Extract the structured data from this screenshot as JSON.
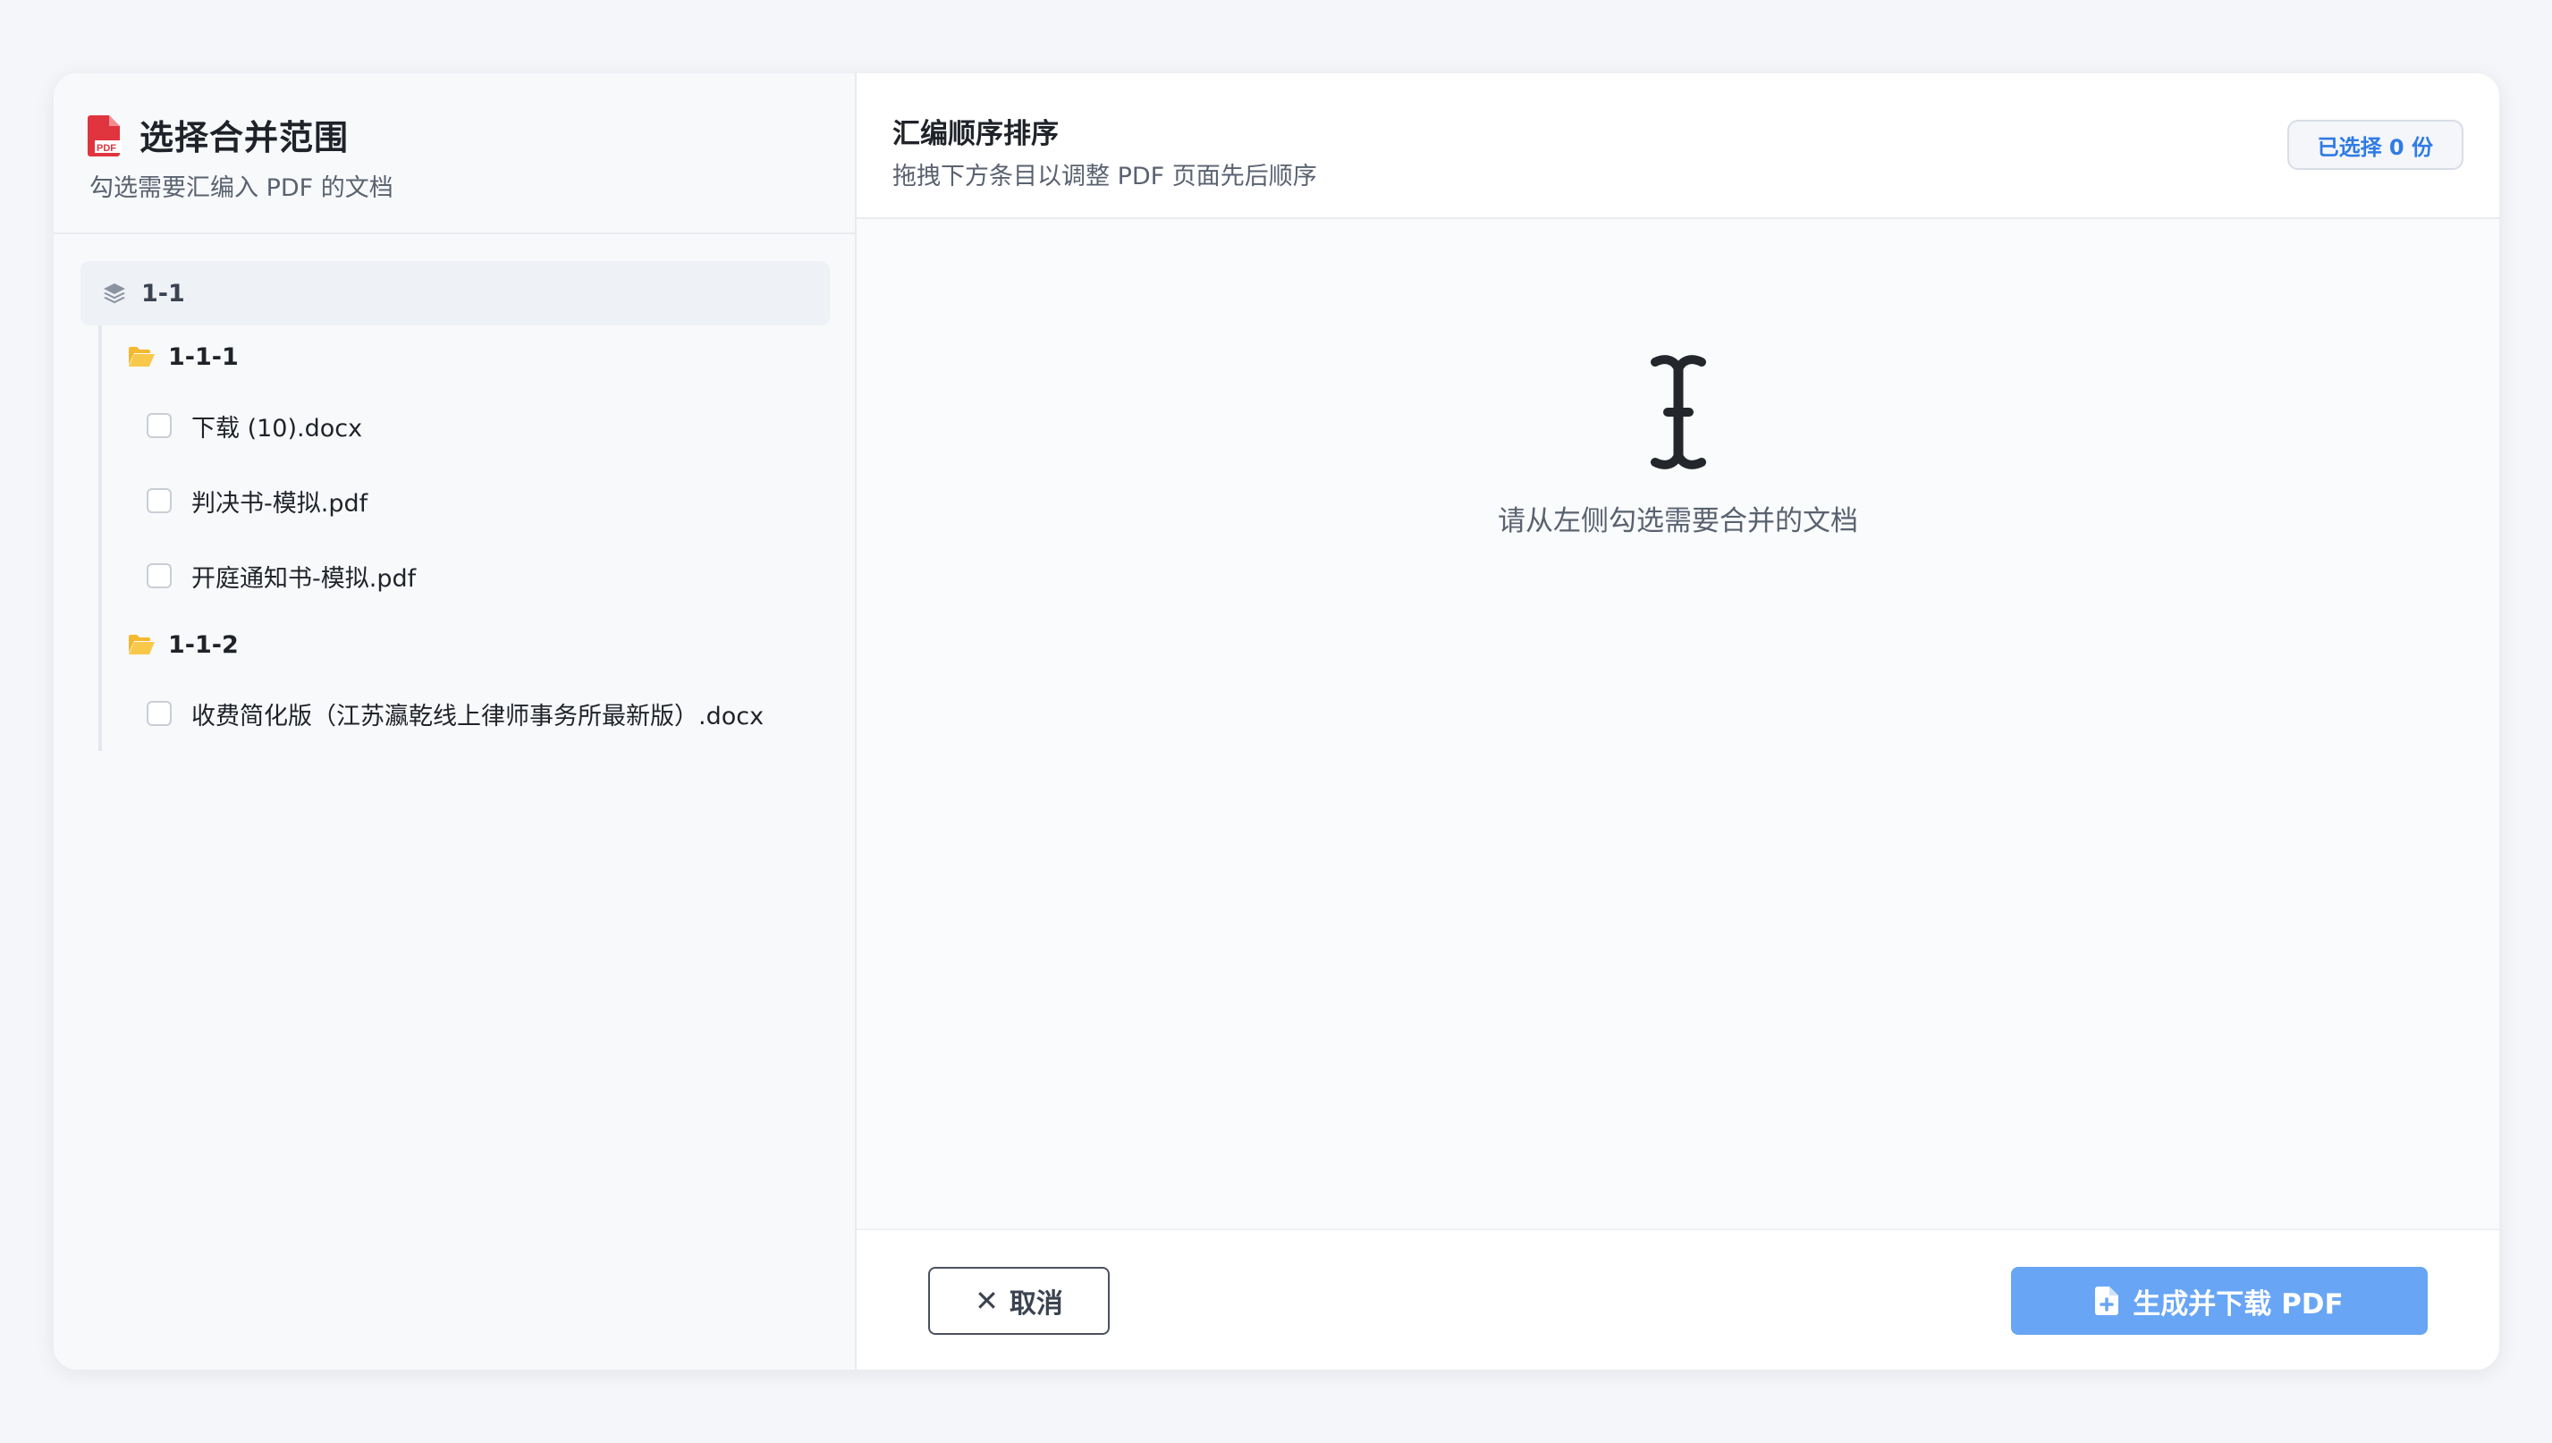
{
  "left_panel": {
    "title": "选择合并范围",
    "subtitle": "勾选需要汇编入 PDF 的文档",
    "title_icon": "pdf-file-icon",
    "tree": {
      "root": {
        "label": "1-1",
        "icon": "layers-icon"
      },
      "folders": [
        {
          "label": "1-1-1",
          "icon": "folder-open-icon",
          "files": [
            {
              "name": "下载 (10).docx",
              "checked": false
            },
            {
              "name": "判决书-模拟.pdf",
              "checked": false
            },
            {
              "name": "开庭通知书-模拟.pdf",
              "checked": false
            }
          ]
        },
        {
          "label": "1-1-2",
          "icon": "folder-open-icon",
          "files": [
            {
              "name": "收费简化版（江苏瀛乾线上律师事务所最新版）.docx",
              "checked": false
            }
          ]
        }
      ]
    }
  },
  "right_panel": {
    "title": "汇编顺序排序",
    "subtitle": "拖拽下方条目以调整 PDF 页面先后顺序",
    "selected_badge": "已选择 0 份",
    "empty_state": {
      "icon": "text-cursor-icon",
      "text": "请从左侧勾选需要合并的文档"
    },
    "footer": {
      "cancel_label": "取消",
      "generate_label": "生成并下载 PDF"
    }
  },
  "colors": {
    "accent": "#2f7be5",
    "primary_button": "#68a5f5",
    "pdf_icon": "#e0343f",
    "folder_icon": "#f5b82e"
  }
}
